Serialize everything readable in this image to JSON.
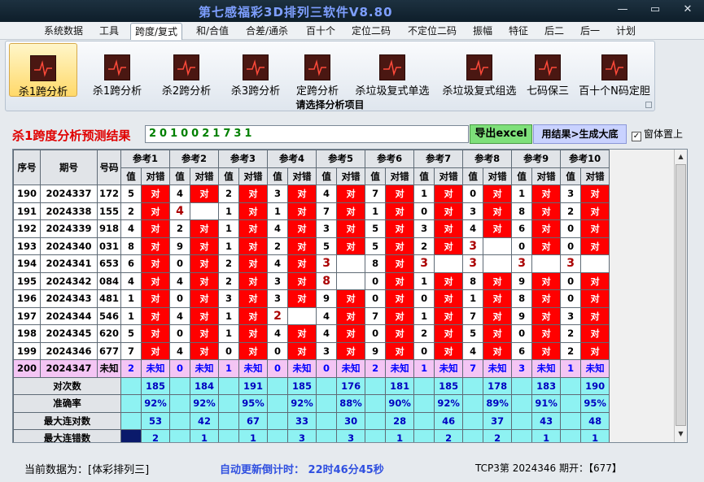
{
  "window": {
    "title": "第七感福彩3D排列三软件V8.80",
    "minimize": "—",
    "maximize": "▭",
    "close": "✕"
  },
  "menu": [
    "系统数据",
    "工具",
    "跨度/复式",
    "和/合值",
    "合差/通杀",
    "百十个",
    "定位二码",
    "不定位二码",
    "振幅",
    "特征",
    "后二",
    "后一",
    "计划"
  ],
  "ribbon": {
    "items": [
      "杀1跨分析",
      "杀1跨分析",
      "杀2跨分析",
      "杀3跨分析",
      "定跨分析",
      "杀垃圾复式单选",
      "杀垃圾复式组选",
      "七码保三",
      "百十个N码定胆"
    ],
    "caption": "请选择分析项目"
  },
  "result": {
    "title": "杀1跨度分析预测结果",
    "value": "2010021731",
    "excel_btn": "导出excel",
    "gen_btn": "用结果>生成大底",
    "pin_label": "窗体置上",
    "pin_checked": "✓"
  },
  "table": {
    "h_index": "序号",
    "h_issue": "期号",
    "h_code": "号码",
    "refs": [
      "参考1",
      "参考2",
      "参考3",
      "参考4",
      "参考5",
      "参考6",
      "参考7",
      "参考8",
      "参考9",
      "参考10"
    ],
    "sub_val": "值",
    "sub_ok": "对错",
    "ok_text": "对",
    "unknown": "未知",
    "rows": [
      {
        "idx": "190",
        "issue": "2024337",
        "code": "172",
        "vals": [
          "5",
          "4",
          "2",
          "3",
          "4",
          "7",
          "1",
          "0",
          "1",
          "3"
        ],
        "ok": [
          1,
          1,
          1,
          1,
          1,
          1,
          1,
          1,
          1,
          1
        ]
      },
      {
        "idx": "191",
        "issue": "2024338",
        "code": "155",
        "vals": [
          "2",
          "4",
          "1",
          "1",
          "7",
          "1",
          "0",
          "3",
          "8",
          "2"
        ],
        "ok": [
          1,
          0,
          1,
          1,
          1,
          1,
          1,
          1,
          1,
          1
        ]
      },
      {
        "idx": "192",
        "issue": "2024339",
        "code": "918",
        "vals": [
          "4",
          "2",
          "1",
          "4",
          "3",
          "5",
          "3",
          "4",
          "6",
          "0"
        ],
        "ok": [
          1,
          1,
          1,
          1,
          1,
          1,
          1,
          1,
          1,
          1
        ]
      },
      {
        "idx": "193",
        "issue": "2024340",
        "code": "031",
        "vals": [
          "8",
          "9",
          "1",
          "2",
          "5",
          "5",
          "2",
          "3",
          "0",
          "0"
        ],
        "ok": [
          1,
          1,
          1,
          1,
          1,
          1,
          1,
          0,
          1,
          1
        ]
      },
      {
        "idx": "194",
        "issue": "2024341",
        "code": "653",
        "vals": [
          "6",
          "0",
          "2",
          "4",
          "3",
          "8",
          "3",
          "3",
          "3",
          "3"
        ],
        "ok": [
          1,
          1,
          1,
          1,
          0,
          1,
          0,
          0,
          0,
          0
        ]
      },
      {
        "idx": "195",
        "issue": "2024342",
        "code": "084",
        "vals": [
          "4",
          "4",
          "2",
          "3",
          "8",
          "0",
          "1",
          "8",
          "9",
          "0"
        ],
        "ok": [
          1,
          1,
          1,
          1,
          0,
          1,
          1,
          1,
          1,
          1
        ]
      },
      {
        "idx": "196",
        "issue": "2024343",
        "code": "481",
        "vals": [
          "1",
          "0",
          "3",
          "3",
          "9",
          "0",
          "0",
          "1",
          "8",
          "0"
        ],
        "ok": [
          1,
          1,
          1,
          1,
          1,
          1,
          1,
          1,
          1,
          1
        ]
      },
      {
        "idx": "197",
        "issue": "2024344",
        "code": "546",
        "vals": [
          "1",
          "4",
          "1",
          "2",
          "4",
          "7",
          "1",
          "7",
          "9",
          "3"
        ],
        "ok": [
          1,
          1,
          1,
          0,
          1,
          1,
          1,
          1,
          1,
          1
        ]
      },
      {
        "idx": "198",
        "issue": "2024345",
        "code": "620",
        "vals": [
          "5",
          "0",
          "1",
          "4",
          "4",
          "0",
          "2",
          "5",
          "0",
          "2"
        ],
        "ok": [
          1,
          1,
          1,
          1,
          1,
          1,
          1,
          1,
          1,
          1
        ]
      },
      {
        "idx": "199",
        "issue": "2024346",
        "code": "677",
        "vals": [
          "7",
          "4",
          "0",
          "0",
          "3",
          "9",
          "0",
          "4",
          "6",
          "2"
        ],
        "ok": [
          1,
          1,
          1,
          1,
          1,
          1,
          1,
          1,
          1,
          1
        ]
      }
    ],
    "last": {
      "idx": "200",
      "issue": "2024347",
      "code": "未知",
      "vals": [
        "2",
        "0",
        "1",
        "0",
        "0",
        "2",
        "1",
        "7",
        "3",
        "1"
      ]
    },
    "stats": [
      {
        "label": "对次数",
        "vals": [
          "185",
          "184",
          "191",
          "185",
          "176",
          "181",
          "185",
          "178",
          "183",
          "190"
        ]
      },
      {
        "label": "准确率",
        "vals": [
          "92%",
          "92%",
          "95%",
          "92%",
          "88%",
          "90%",
          "92%",
          "89%",
          "91%",
          "95%"
        ]
      },
      {
        "label": "最大连对数",
        "vals": [
          "53",
          "42",
          "67",
          "33",
          "30",
          "28",
          "46",
          "37",
          "43",
          "48"
        ]
      },
      {
        "label": "最大连错数",
        "vals": [
          "2",
          "1",
          "1",
          "3",
          "3",
          "1",
          "2",
          "2",
          "1",
          "1"
        ]
      }
    ]
  },
  "status": {
    "current": "当前数据为：[体彩排列三]",
    "countdown": "自动更新倒计时：  22时46分45秒",
    "period": "TCP3第 2024346 期开：【677】"
  },
  "colors": {
    "ok_red": "#ff0000",
    "unknown_pink": "#f4c5f4",
    "stat_cyan": "#8ef2f2",
    "title_blue": "#7e9fff",
    "result_green": "#008000"
  }
}
